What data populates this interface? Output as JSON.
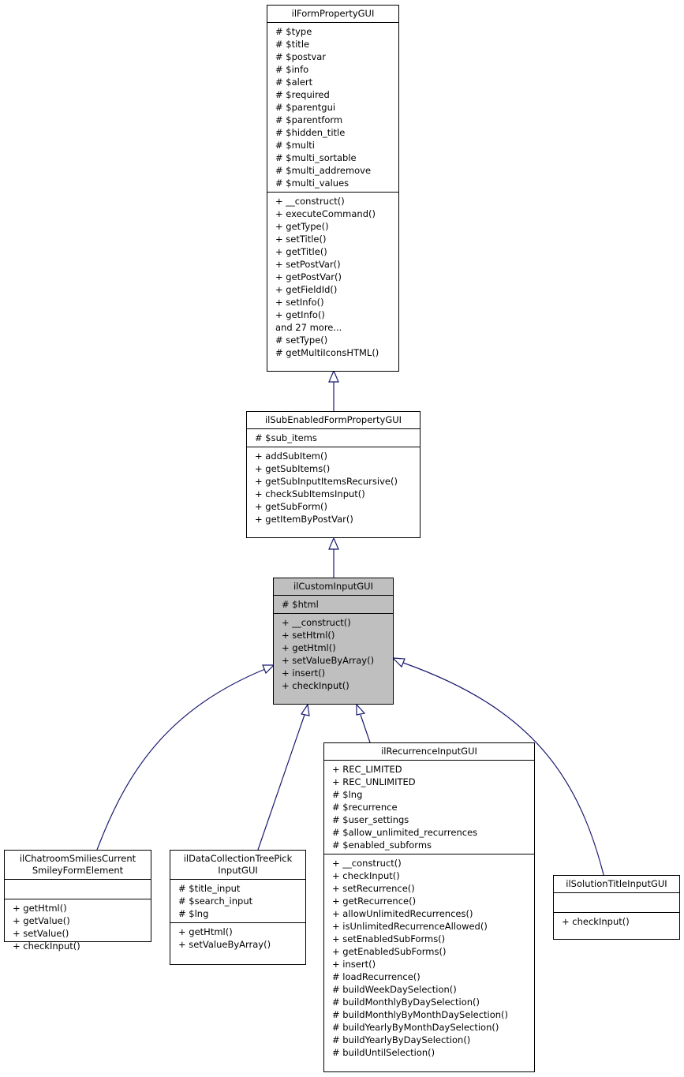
{
  "diagram": {
    "type": "class-inheritance",
    "classes": {
      "form_property": {
        "name": "ilFormPropertyGUI",
        "attributes": [
          "# $type",
          "# $title",
          "# $postvar",
          "# $info",
          "# $alert",
          "# $required",
          "# $parentgui",
          "# $parentform",
          "# $hidden_title",
          "# $multi",
          "# $multi_sortable",
          "# $multi_addremove",
          "# $multi_values"
        ],
        "methods": [
          "+ __construct()",
          "+ executeCommand()",
          "+ getType()",
          "+ setTitle()",
          "+ getTitle()",
          "+ setPostVar()",
          "+ getPostVar()",
          "+ getFieldId()",
          "+ setInfo()",
          "+ getInfo()",
          "and 27 more...",
          "# setType()",
          "# getMultiIconsHTML()"
        ]
      },
      "sub_enabled": {
        "name": "ilSubEnabledFormPropertyGUI",
        "attributes": [
          "# $sub_items"
        ],
        "methods": [
          "+ addSubItem()",
          "+ getSubItems()",
          "+ getSubInputItemsRecursive()",
          "+ checkSubItemsInput()",
          "+ getSubForm()",
          "+ getItemByPostVar()"
        ]
      },
      "custom_input": {
        "name": "ilCustomInputGUI",
        "highlighted": true,
        "attributes": [
          "# $html"
        ],
        "methods": [
          "+ __construct()",
          "+ setHtml()",
          "+ getHtml()",
          "+ setValueByArray()",
          "+ insert()",
          "+ checkInput()"
        ]
      },
      "chatroom": {
        "name_lines": [
          "ilChatroomSmiliesCurrent",
          "SmileyFormElement"
        ],
        "attributes": [],
        "methods": [
          "+ getHtml()",
          "+ getValue()",
          "+ setValue()",
          "+ checkInput()"
        ]
      },
      "datacollection": {
        "name_lines": [
          "ilDataCollectionTreePick",
          "InputGUI"
        ],
        "attributes": [
          "# $title_input",
          "# $search_input",
          "# $lng"
        ],
        "methods": [
          "+ getHtml()",
          "+ setValueByArray()"
        ]
      },
      "recurrence": {
        "name": "ilRecurrenceInputGUI",
        "attributes": [
          "+ REC_LIMITED",
          "+ REC_UNLIMITED",
          "# $lng",
          "# $recurrence",
          "# $user_settings",
          "# $allow_unlimited_recurrences",
          "# $enabled_subforms"
        ],
        "methods": [
          "+ __construct()",
          "+ checkInput()",
          "+ setRecurrence()",
          "+ getRecurrence()",
          "+ allowUnlimitedRecurrences()",
          "+ isUnlimitedRecurrenceAllowed()",
          "+ setEnabledSubForms()",
          "+ getEnabledSubForms()",
          "+ insert()",
          "# loadRecurrence()",
          "# buildWeekDaySelection()",
          "# buildMonthlyByDaySelection()",
          "# buildMonthlyByMonthDaySelection()",
          "# buildYearlyByMonthDaySelection()",
          "# buildYearlyByDaySelection()",
          "# buildUntilSelection()"
        ]
      },
      "solution_title": {
        "name": "ilSolutionTitleInputGUI",
        "attributes": [],
        "methods": [
          "+ checkInput()"
        ]
      }
    },
    "inheritance": [
      {
        "child": "ilSubEnabledFormPropertyGUI",
        "parent": "ilFormPropertyGUI"
      },
      {
        "child": "ilCustomInputGUI",
        "parent": "ilSubEnabledFormPropertyGUI"
      },
      {
        "child": "ilChatroomSmiliesCurrentSmileyFormElement",
        "parent": "ilCustomInputGUI"
      },
      {
        "child": "ilDataCollectionTreePickInputGUI",
        "parent": "ilCustomInputGUI"
      },
      {
        "child": "ilRecurrenceInputGUI",
        "parent": "ilCustomInputGUI"
      },
      {
        "child": "ilSolutionTitleInputGUI",
        "parent": "ilCustomInputGUI"
      }
    ],
    "colors": {
      "edge": "#191970",
      "highlight_fill": "#bfbfbf",
      "box_fill": "#ffffff",
      "border": "#000000"
    }
  }
}
